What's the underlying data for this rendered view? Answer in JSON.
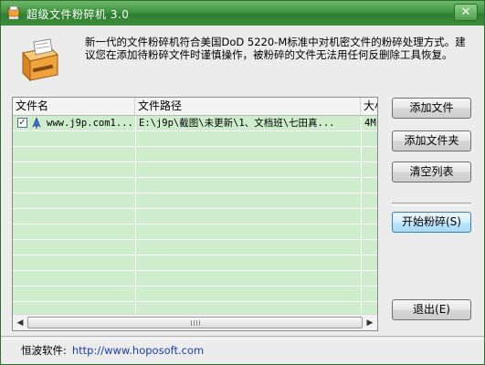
{
  "window": {
    "title": "超级文件粉碎机  3.0",
    "close_label": "✕"
  },
  "description": "新一代的文件粉碎机符合美国DoD 5220-M标准中对机密文件的粉碎处理方式。建议您在添加待粉碎文件时谨慎操作，被粉碎的文件无法用任何反删除工具恢复。",
  "table": {
    "columns": [
      "文件名",
      "文件路径",
      "大小"
    ],
    "rows": [
      {
        "checked": true,
        "name": "www.j9p.com1...",
        "path": "E:\\j9p\\截图\\未更新\\1、文档班\\七田真...",
        "size": "4M"
      }
    ]
  },
  "buttons": {
    "add_file": "添加文件",
    "add_folder": "添加文件夹",
    "clear_list": "清空列表",
    "start_shred": "开始粉碎(S)",
    "exit": "退出(E)"
  },
  "footer": {
    "label": "恒波软件:",
    "link": "http://www.hoposoft.com"
  },
  "colors": {
    "titlebar": "#3f9440",
    "list_background": "#cdedcc",
    "link": "#1a3fa8"
  }
}
